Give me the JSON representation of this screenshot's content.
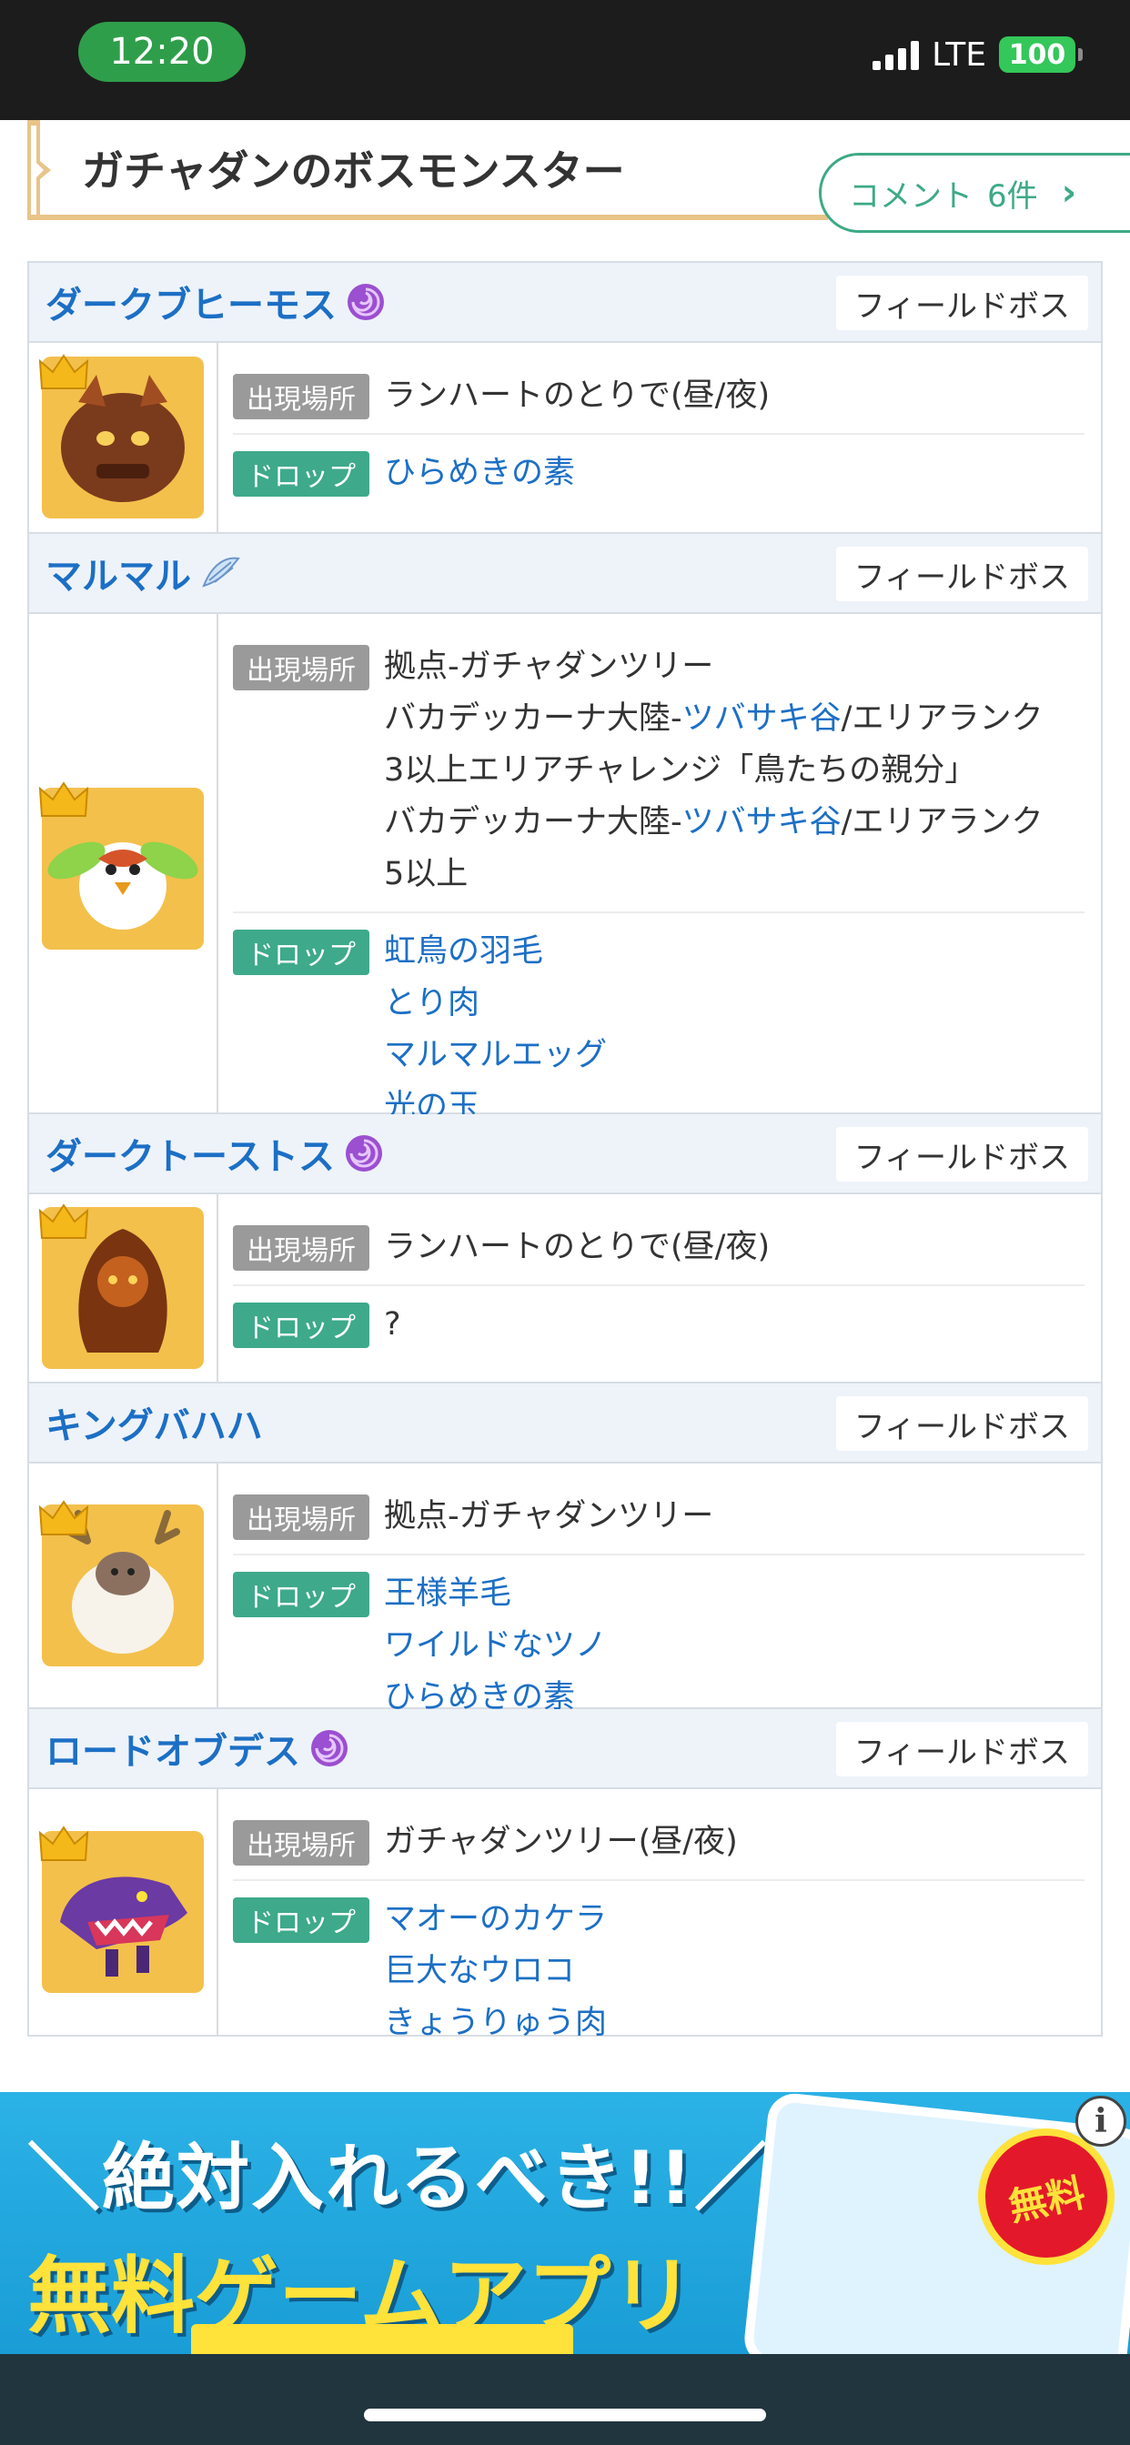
{
  "status_bar": {
    "time": "12:20",
    "network": "LTE",
    "battery": "100"
  },
  "section": {
    "title": "ガチャダンのボスモンスター",
    "comment_label": "コメント",
    "comment_count": "6件"
  },
  "labels": {
    "location": "出現場所",
    "drop": "ドロップ"
  },
  "bosses": [
    {
      "name": "ダークブヒーモス",
      "tag": "フィールドボス",
      "location": [
        "ランハートのとりで(昼/夜)"
      ],
      "drops": [
        "ひらめきの素"
      ]
    },
    {
      "name": "マルマル",
      "tag": "フィールドボス",
      "location": [
        "拠点-ガチャダンツリー",
        [
          "バカデッカーナ大陸-",
          "ツバサキ谷",
          "/エリアランク"
        ],
        "3以上エリアチャレンジ「鳥たちの親分」",
        [
          "バカデッカーナ大陸-",
          "ツバサキ谷",
          "/エリアランク"
        ],
        "5以上"
      ],
      "drops": [
        "虹鳥の羽毛",
        "とり肉",
        "マルマルエッグ",
        "光の玉"
      ]
    },
    {
      "name": "ダークトーストス",
      "tag": "フィールドボス",
      "location": [
        "ランハートのとりで(昼/夜)"
      ],
      "drops": [
        "?"
      ]
    },
    {
      "name": "キングバハハ",
      "tag": "フィールドボス",
      "location": [
        "拠点-ガチャダンツリー"
      ],
      "drops": [
        "王様羊毛",
        "ワイルドなツノ",
        "ひらめきの素"
      ]
    },
    {
      "name": "ロードオブデス",
      "tag": "フィールドボス",
      "location": [
        "ガチャダンツリー(昼/夜)"
      ],
      "drops": [
        "マオーのカケラ",
        "巨大なウロコ",
        "きょうりゅう肉"
      ]
    }
  ],
  "ad": {
    "line1": "＼絶対入れるべき!!／",
    "line2": "無料ゲームアプリ",
    "badge": "無料",
    "info": "i"
  },
  "colors": {
    "link": "#1c6fc5",
    "drop_label": "#3ea98b",
    "location_label": "#9a9a9a",
    "header_bg": "#eef3fa",
    "accent_green": "#3daa85"
  }
}
